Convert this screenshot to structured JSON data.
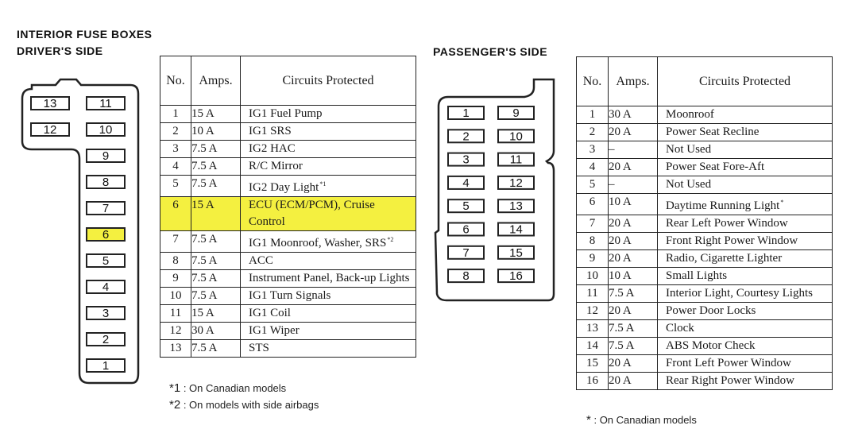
{
  "title": "INTERIOR FUSE BOXES",
  "driver": {
    "heading": "DRIVER'S SIDE",
    "highlighted_fuse": "6",
    "highlight_color": "#f4f040",
    "box_left_column": [
      "13",
      "12"
    ],
    "box_right_column": [
      "11",
      "10",
      "9",
      "8",
      "7",
      "6",
      "5",
      "4",
      "3",
      "2",
      "1"
    ],
    "table": {
      "headers": [
        "No.",
        "Amps.",
        "Circuits Protected"
      ],
      "rows": [
        {
          "no": "1",
          "amps": "15 A",
          "circuit": "IG1 Fuel Pump",
          "note": ""
        },
        {
          "no": "2",
          "amps": "10 A",
          "circuit": "IG1 SRS",
          "note": ""
        },
        {
          "no": "3",
          "amps": "7.5 A",
          "circuit": "IG2 HAC",
          "note": ""
        },
        {
          "no": "4",
          "amps": "7.5 A",
          "circuit": "R/C Mirror",
          "note": ""
        },
        {
          "no": "5",
          "amps": "7.5 A",
          "circuit": "IG2 Day Light",
          "note": "*1"
        },
        {
          "no": "6",
          "amps": "15 A",
          "circuit": "ECU (ECM/PCM), Cruise Control",
          "note": "",
          "highlighted": true
        },
        {
          "no": "7",
          "amps": "7.5 A",
          "circuit": "IG1 Moonroof, Washer, SRS",
          "note": "*2"
        },
        {
          "no": "8",
          "amps": "7.5 A",
          "circuit": "ACC",
          "note": ""
        },
        {
          "no": "9",
          "amps": "7.5 A",
          "circuit": "Instrument Panel, Back-up Lights",
          "note": ""
        },
        {
          "no": "10",
          "amps": "7.5 A",
          "circuit": "IG1 Turn Signals",
          "note": ""
        },
        {
          "no": "11",
          "amps": "15 A",
          "circuit": "IG1 Coil",
          "note": ""
        },
        {
          "no": "12",
          "amps": "30 A",
          "circuit": "IG1 Wiper",
          "note": ""
        },
        {
          "no": "13",
          "amps": "7.5 A",
          "circuit": "STS",
          "note": ""
        }
      ]
    },
    "footnotes": [
      {
        "mark": "*1",
        "text": ": On Canadian models"
      },
      {
        "mark": "*2",
        "text": ": On models with side airbags"
      }
    ]
  },
  "passenger": {
    "heading": "PASSENGER'S SIDE",
    "box_left_column": [
      "1",
      "2",
      "3",
      "4",
      "5",
      "6",
      "7",
      "8"
    ],
    "box_right_column": [
      "9",
      "10",
      "11",
      "12",
      "13",
      "14",
      "15",
      "16"
    ],
    "table": {
      "headers": [
        "No.",
        "Amps.",
        "Circuits Protected"
      ],
      "rows": [
        {
          "no": "1",
          "amps": "30 A",
          "circuit": "Moonroof",
          "note": ""
        },
        {
          "no": "2",
          "amps": "20 A",
          "circuit": "Power Seat Recline",
          "note": ""
        },
        {
          "no": "3",
          "amps": "–",
          "circuit": "Not Used",
          "note": ""
        },
        {
          "no": "4",
          "amps": "20 A",
          "circuit": "Power Seat Fore-Aft",
          "note": ""
        },
        {
          "no": "5",
          "amps": "–",
          "circuit": "Not Used",
          "note": ""
        },
        {
          "no": "6",
          "amps": "10 A",
          "circuit": "Daytime Running Light",
          "note": "*"
        },
        {
          "no": "7",
          "amps": "20 A",
          "circuit": "Rear Left Power Window",
          "note": ""
        },
        {
          "no": "8",
          "amps": "20 A",
          "circuit": "Front Right Power Window",
          "note": ""
        },
        {
          "no": "9",
          "amps": "20 A",
          "circuit": "Radio, Cigarette Lighter",
          "note": ""
        },
        {
          "no": "10",
          "amps": "10 A",
          "circuit": "Small Lights",
          "note": ""
        },
        {
          "no": "11",
          "amps": "7.5 A",
          "circuit": "Interior Light, Courtesy Lights",
          "note": ""
        },
        {
          "no": "12",
          "amps": "20 A",
          "circuit": "Power Door Locks",
          "note": ""
        },
        {
          "no": "13",
          "amps": "7.5 A",
          "circuit": "Clock",
          "note": ""
        },
        {
          "no": "14",
          "amps": "7.5 A",
          "circuit": "ABS Motor Check",
          "note": ""
        },
        {
          "no": "15",
          "amps": "20 A",
          "circuit": "Front Left Power Window",
          "note": ""
        },
        {
          "no": "16",
          "amps": "20 A",
          "circuit": "Rear Right Power Window",
          "note": ""
        }
      ]
    },
    "footnotes": [
      {
        "mark": "*",
        "text": ": On Canadian models"
      }
    ]
  }
}
